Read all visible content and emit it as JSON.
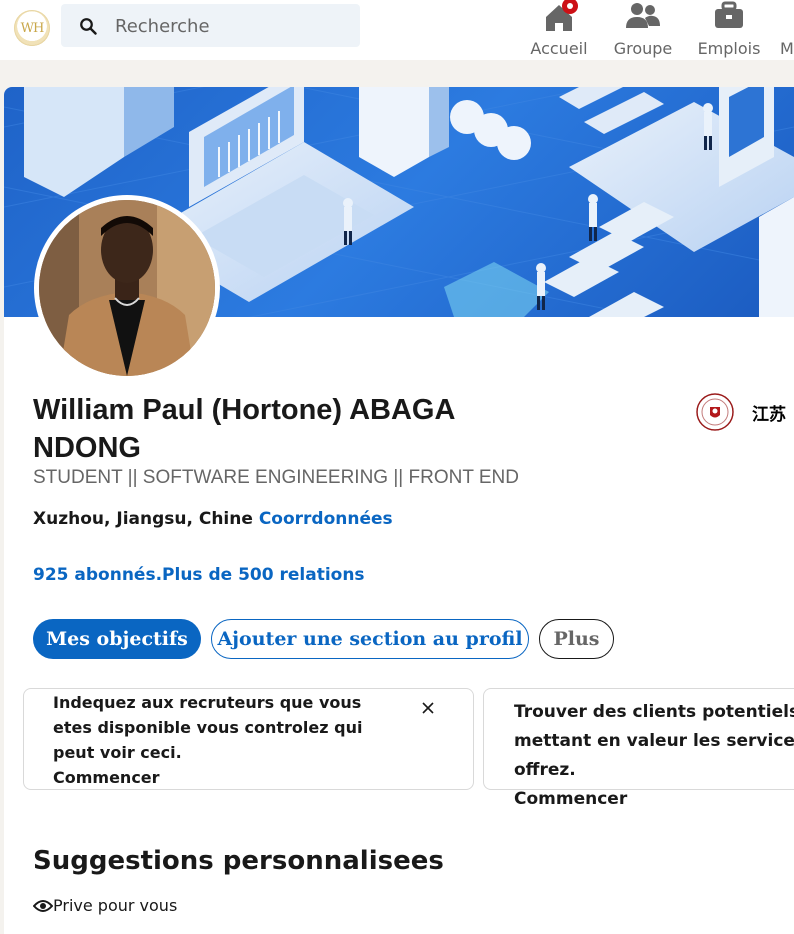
{
  "nav": {
    "logo_text": "WH",
    "search_placeholder": "Recherche",
    "items": [
      {
        "label": "Accueil",
        "icon": "home-icon"
      },
      {
        "label": "Groupe",
        "icon": "people-icon"
      },
      {
        "label": "Emplois",
        "icon": "briefcase-icon"
      },
      {
        "label": "M",
        "icon": "messaging-icon"
      }
    ],
    "notification_color": "#cc1016"
  },
  "profile": {
    "name": "William Paul (Hortone) ABAGA NDONG",
    "headline": "STUDENT || SOFTWARE ENGINEERING || FRONT END",
    "location": "Xuzhou, Jiangsu, Chine",
    "contact_link": "Coorrdonnées",
    "network": "925 abonnés.Plus de 500 relations",
    "school": "江苏",
    "accent_color": "#0a66c2"
  },
  "actions": {
    "primary": "Mes objectifs",
    "secondary": "Ajouter une section au profil",
    "more": "Plus"
  },
  "tips": [
    {
      "text": "Indequez aux recruteurs que vous etes disponible vous controlez qui peut voir ceci.",
      "cta": "Commencer",
      "close": "X"
    },
    {
      "text": "Trouver des clients potentiels mettant en valeur les services offrez.",
      "cta": "Commencer"
    }
  ],
  "suggestions": {
    "title": "Suggestions personnalisees",
    "privacy": "Prive pour vous"
  }
}
